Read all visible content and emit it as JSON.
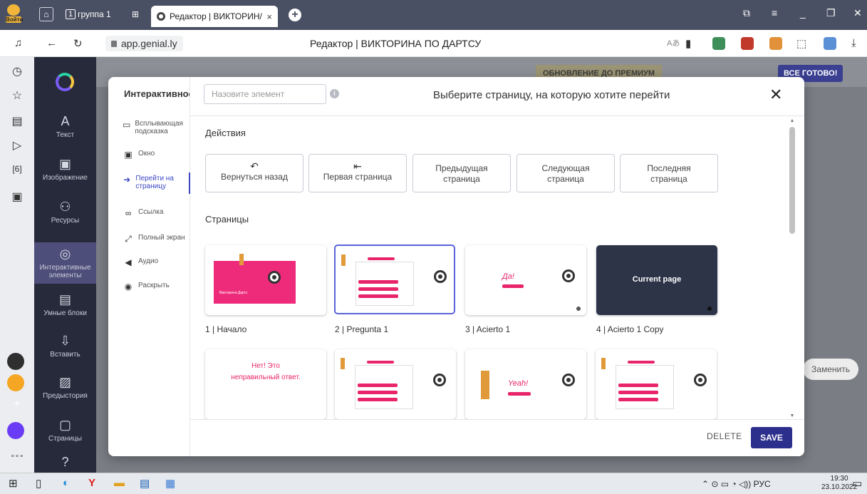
{
  "browser": {
    "login_label": "Войти",
    "group_num": "1",
    "group_label": "группа 1",
    "tab_title": "Редактор | ВИКТОРИН/",
    "tab_close": "×",
    "new_tab": "+",
    "url": "app.genial.ly",
    "page_title": "Редактор | ВИКТОРИНА ПО ДАРТСУ"
  },
  "editor": {
    "upgrade_label": "ОБНОВЛЕНИЕ ДО ПРЕМИУМ",
    "ready_label": "ВСЕ ГОТОВО!",
    "replace_label": "Заменить",
    "sidebar": [
      {
        "label": "Текст",
        "icon": "A"
      },
      {
        "label": "Изображение",
        "icon": "▣"
      },
      {
        "label": "Ресурсы",
        "icon": "⚇"
      },
      {
        "label": "Интерактивные элементы",
        "icon": "◎"
      },
      {
        "label": "Умные блоки",
        "icon": "▤"
      },
      {
        "label": "Вставить",
        "icon": "⇩"
      },
      {
        "label": "Предыстория",
        "icon": "▨"
      },
      {
        "label": "Страницы",
        "icon": "▢"
      }
    ]
  },
  "modal": {
    "left_header": "Интерактивнос",
    "menu": [
      {
        "label": "Всплывающая подсказка",
        "icon": "▭"
      },
      {
        "label": "Окно",
        "icon": "▣"
      },
      {
        "label": "Перейти на страницу",
        "icon": "➜"
      },
      {
        "label": "Ссылка",
        "icon": "∞"
      },
      {
        "label": "Полный экран",
        "icon": "⤢"
      },
      {
        "label": "Аудио",
        "icon": "◀"
      },
      {
        "label": "Раскрыть",
        "icon": "◉"
      }
    ],
    "name_placeholder": "Назовите элемент",
    "title": "Выберите страницу, на которую хотите перейти",
    "close": "✕",
    "actions_title": "Действия",
    "actions": [
      {
        "label": "Вернуться назад",
        "icon": "↶"
      },
      {
        "label": "Первая страница",
        "icon": "⇤"
      },
      {
        "label": "Предыдущая страница",
        "icon": ""
      },
      {
        "label": "Следующая страница",
        "icon": ""
      },
      {
        "label": "Последняя страница",
        "icon": ""
      }
    ],
    "pages_title": "Страницы",
    "pages": [
      {
        "label": "1 | Начало",
        "thumb_text": "Викторина Дартс"
      },
      {
        "label": "2 | Pregunta 1",
        "thumb_text": ""
      },
      {
        "label": "3 | Acierto 1",
        "thumb_text": "Да!"
      },
      {
        "label": "4 | Acierto 1 Copy",
        "thumb_text": "Current page"
      },
      {
        "label": "",
        "thumb_text": "Нет! Это неправильный ответ."
      },
      {
        "label": "",
        "thumb_text": ""
      },
      {
        "label": "",
        "thumb_text": "Yeah!"
      },
      {
        "label": "",
        "thumb_text": ""
      }
    ],
    "delete_label": "DELETE",
    "save_label": "SAVE"
  },
  "taskbar": {
    "tray_lang": "РУС",
    "time": "19:30",
    "date": "23.10.2022"
  }
}
